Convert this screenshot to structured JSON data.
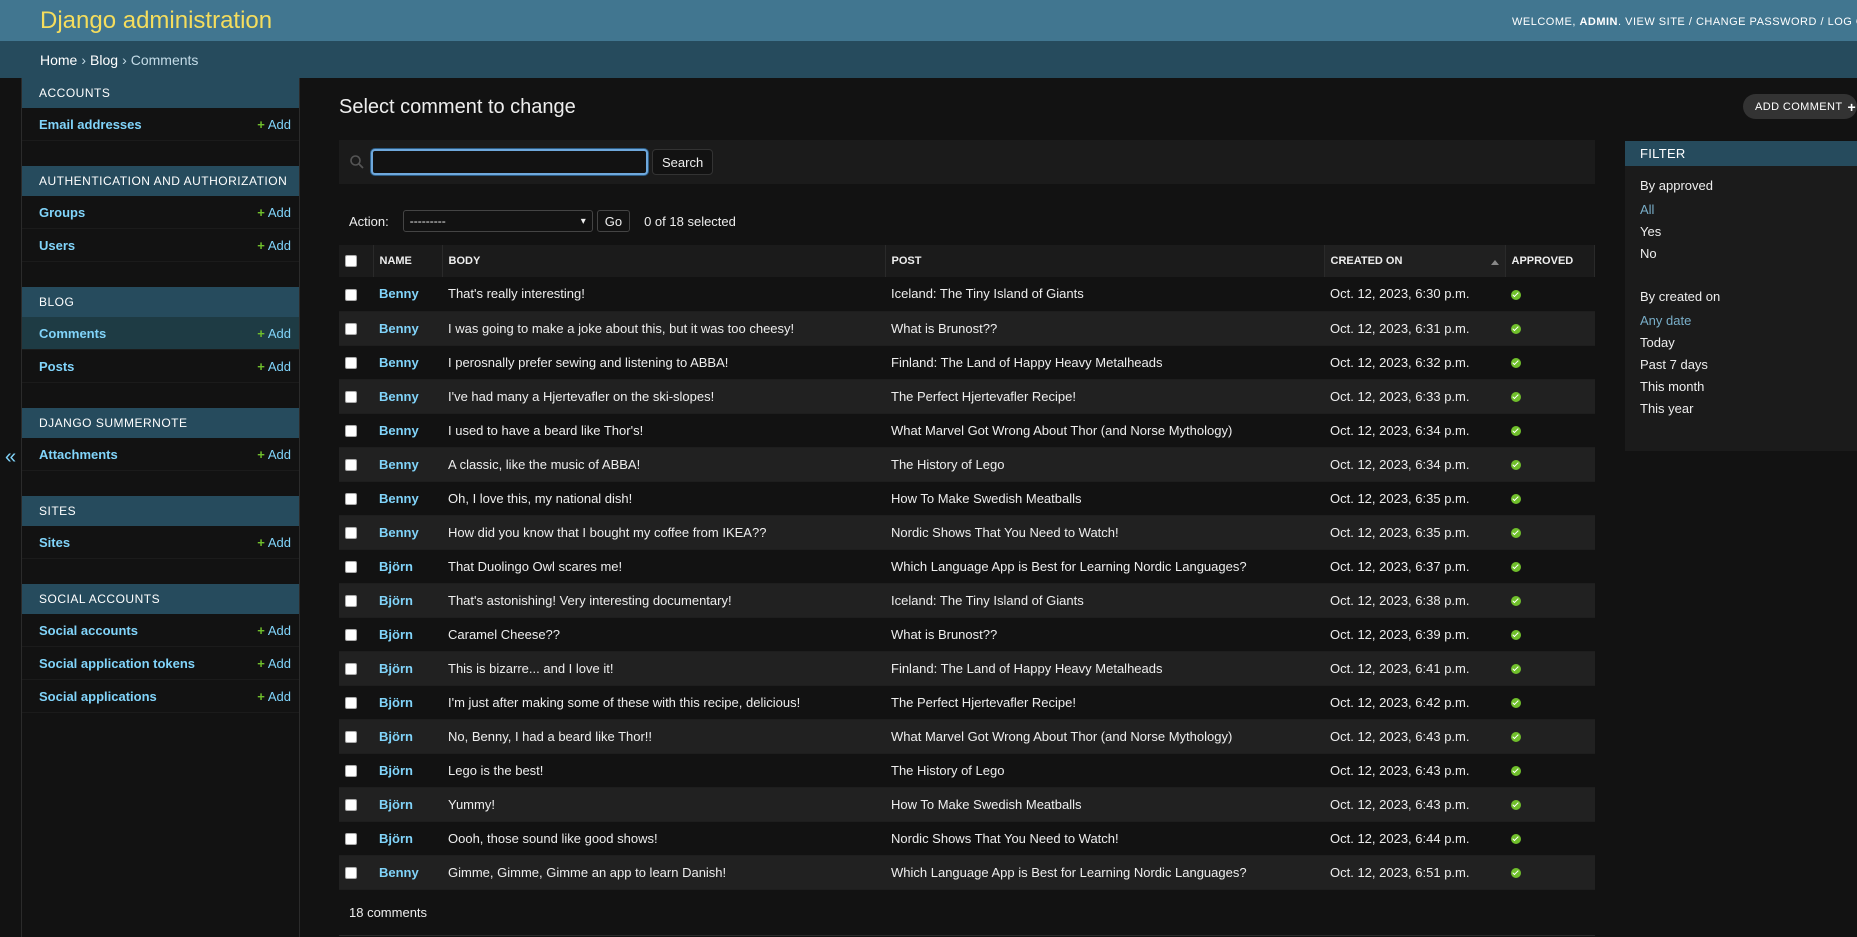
{
  "header": {
    "branding": "Django administration",
    "welcome": "Welcome, ",
    "user": "admin",
    "view_site": "View site",
    "change_password": "Change password",
    "log_out": "Log out",
    "separator": " / "
  },
  "breadcrumbs": {
    "home": "Home",
    "app": "Blog",
    "current": "Comments",
    "sep": "›"
  },
  "nav_toggle": "«",
  "sidebar": {
    "add_label": "Add",
    "modules": [
      {
        "caption": "Accounts",
        "items": [
          "Email addresses"
        ]
      },
      {
        "caption": "Authentication and Authorization",
        "items": [
          "Groups",
          "Users"
        ]
      },
      {
        "caption": "Blog",
        "items": [
          "Comments",
          "Posts"
        ]
      },
      {
        "caption": "Django Summernote",
        "items": [
          "Attachments"
        ]
      },
      {
        "caption": "Sites",
        "items": [
          "Sites"
        ]
      },
      {
        "caption": "Social Accounts",
        "items": [
          "Social accounts",
          "Social application tokens",
          "Social applications"
        ]
      }
    ]
  },
  "content": {
    "title": "Select comment to change",
    "add_button": "Add Comment",
    "search": {
      "value": "",
      "button": "Search"
    },
    "actions": {
      "label": "Action:",
      "selected": "---------",
      "go": "Go",
      "count": "0 of 18 selected"
    },
    "columns": [
      "Name",
      "Body",
      "Post",
      "Created on",
      "Approved"
    ],
    "rows": [
      {
        "name": "Benny",
        "body": "That's really interesting!",
        "post": "Iceland: The Tiny Island of Giants",
        "created": "Oct. 12, 2023, 6:30 p.m.",
        "approved": true
      },
      {
        "name": "Benny",
        "body": "I was going to make a joke about this, but it was too cheesy!",
        "post": "What is Brunost??",
        "created": "Oct. 12, 2023, 6:31 p.m.",
        "approved": true
      },
      {
        "name": "Benny",
        "body": "I perosnally prefer sewing and listening to ABBA!",
        "post": "Finland: The Land of Happy Heavy Metalheads",
        "created": "Oct. 12, 2023, 6:32 p.m.",
        "approved": true
      },
      {
        "name": "Benny",
        "body": "I've had many a Hjertevafler on the ski-slopes!",
        "post": "The Perfect Hjertevafler Recipe!",
        "created": "Oct. 12, 2023, 6:33 p.m.",
        "approved": true
      },
      {
        "name": "Benny",
        "body": "I used to have a beard like Thor's!",
        "post": "What Marvel Got Wrong About Thor (and Norse Mythology)",
        "created": "Oct. 12, 2023, 6:34 p.m.",
        "approved": true
      },
      {
        "name": "Benny",
        "body": "A classic, like the music of ABBA!",
        "post": "The History of Lego",
        "created": "Oct. 12, 2023, 6:34 p.m.",
        "approved": true
      },
      {
        "name": "Benny",
        "body": "Oh, I love this, my national dish!",
        "post": "How To Make Swedish Meatballs",
        "created": "Oct. 12, 2023, 6:35 p.m.",
        "approved": true
      },
      {
        "name": "Benny",
        "body": "How did you know that I bought my coffee from IKEA??",
        "post": "Nordic Shows That You Need to Watch!",
        "created": "Oct. 12, 2023, 6:35 p.m.",
        "approved": true
      },
      {
        "name": "Björn",
        "body": "That Duolingo Owl scares me!",
        "post": "Which Language App is Best for Learning Nordic Languages?",
        "created": "Oct. 12, 2023, 6:37 p.m.",
        "approved": true
      },
      {
        "name": "Björn",
        "body": "That's astonishing! Very interesting documentary!",
        "post": "Iceland: The Tiny Island of Giants",
        "created": "Oct. 12, 2023, 6:38 p.m.",
        "approved": true
      },
      {
        "name": "Björn",
        "body": "Caramel Cheese??",
        "post": "What is Brunost??",
        "created": "Oct. 12, 2023, 6:39 p.m.",
        "approved": true
      },
      {
        "name": "Björn",
        "body": "This is bizarre... and I love it!",
        "post": "Finland: The Land of Happy Heavy Metalheads",
        "created": "Oct. 12, 2023, 6:41 p.m.",
        "approved": true
      },
      {
        "name": "Björn",
        "body": "I'm just after making some of these with this recipe, delicious!",
        "post": "The Perfect Hjertevafler Recipe!",
        "created": "Oct. 12, 2023, 6:42 p.m.",
        "approved": true
      },
      {
        "name": "Björn",
        "body": "No, Benny, I had a beard like Thor!!",
        "post": "What Marvel Got Wrong About Thor (and Norse Mythology)",
        "created": "Oct. 12, 2023, 6:43 p.m.",
        "approved": true
      },
      {
        "name": "Björn",
        "body": "Lego is the best!",
        "post": "The History of Lego",
        "created": "Oct. 12, 2023, 6:43 p.m.",
        "approved": true
      },
      {
        "name": "Björn",
        "body": "Yummy!",
        "post": "How To Make Swedish Meatballs",
        "created": "Oct. 12, 2023, 6:43 p.m.",
        "approved": true
      },
      {
        "name": "Björn",
        "body": "Oooh, those sound like good shows!",
        "post": "Nordic Shows That You Need to Watch!",
        "created": "Oct. 12, 2023, 6:44 p.m.",
        "approved": true
      },
      {
        "name": "Benny",
        "body": "Gimme, Gimme, Gimme an app to learn Danish!",
        "post": "Which Language App is Best for Learning Nordic Languages?",
        "created": "Oct. 12, 2023, 6:51 p.m.",
        "approved": true
      }
    ],
    "paginator": "18 comments"
  },
  "filter": {
    "title": "Filter",
    "groups": [
      {
        "heading": "By approved",
        "options": [
          "All",
          "Yes",
          "No"
        ],
        "selected": "All"
      },
      {
        "heading": "By created on",
        "options": [
          "Any date",
          "Today",
          "Past 7 days",
          "This month",
          "This year"
        ],
        "selected": "Any date"
      }
    ]
  },
  "colors": {
    "header": "#417690",
    "breadcrumbs": "#264b5d",
    "branding": "#f5dd5d",
    "link": "#81d4fa",
    "add": "#70bf2b"
  },
  "icons": {
    "search": "search-icon",
    "approved": "yes-icon",
    "add": "plus-icon",
    "sort": "sort-ascending-icon",
    "toggle": "chevron-double-left-icon"
  }
}
